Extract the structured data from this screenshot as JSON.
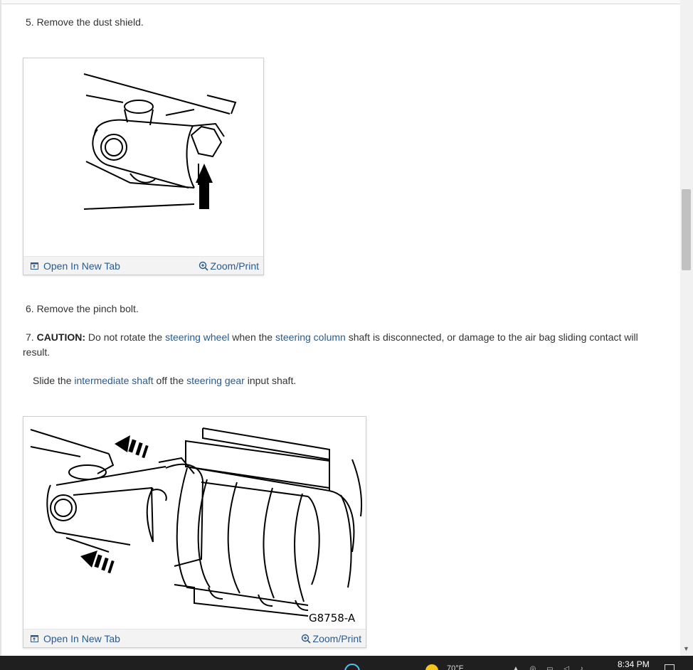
{
  "steps": {
    "step5": "5. Remove the dust shield.",
    "step6": "6. Remove the pinch bolt.",
    "step7_prefix": "7. ",
    "step7_caution": "CAUTION:",
    "step7_t1": " Do not rotate the ",
    "step7_link1": "steering wheel",
    "step7_t2": " when the ",
    "step7_link2": "steering column",
    "step7_t3": " shaft is disconnected, or damage to the air bag sliding contact will result.",
    "slide_t1": "Slide the ",
    "slide_link1": "intermediate shaft",
    "slide_t2": " off the ",
    "slide_link2": "steering gear",
    "slide_t3": " input shaft."
  },
  "figure1": {
    "open_label": "Open In New Tab",
    "zoom_label": "Zoom/Print"
  },
  "figure2": {
    "open_label": "Open In New Tab",
    "zoom_label": "Zoom/Print",
    "caption": "G8758-A"
  },
  "taskbar": {
    "time": "8:34 PM",
    "weather": "70°F",
    "icons": [
      "chrome-icon",
      "weather-sun-icon",
      "tray-icons",
      "notification-icon"
    ]
  },
  "colors": {
    "link": "#2a5a8c",
    "text": "#333333",
    "taskbar": "#1f1f1f"
  }
}
